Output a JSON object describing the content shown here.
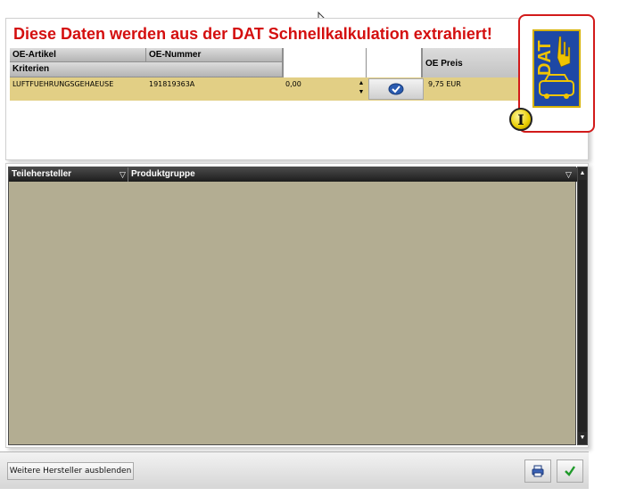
{
  "headline": "Diese Daten werden aus der DAT Schnellkalkulation extrahiert!",
  "oe_table": {
    "headers_row1": [
      "OE-Artikel",
      "OE-Nummer",
      "",
      "",
      "OE Preis"
    ],
    "headers_row2": [
      "Kriterien"
    ],
    "row": {
      "artikel": "LUFTFUEHRUNGSGEHAEUSE",
      "nummer": "191819363A",
      "menge": "0,00",
      "preis": "9,75 EUR"
    }
  },
  "logo": {
    "text": "DAT"
  },
  "info_badge": "I",
  "grid": {
    "columns": [
      "Teilehersteller",
      "Produktgruppe"
    ]
  },
  "footer": {
    "hide_button": "Weitere Hersteller ausblenden"
  },
  "colors": {
    "headline": "#d40f0f",
    "row_highlight": "#e2cf85",
    "grid_bg": "#b3ad92",
    "dat_blue": "#1e48a5"
  },
  "icons": [
    "calculator-icon",
    "dat-logo",
    "info-icon",
    "filter-icon",
    "scroll-up-icon",
    "scroll-down-icon",
    "print-icon",
    "check-icon",
    "mouse-cursor-icon"
  ]
}
